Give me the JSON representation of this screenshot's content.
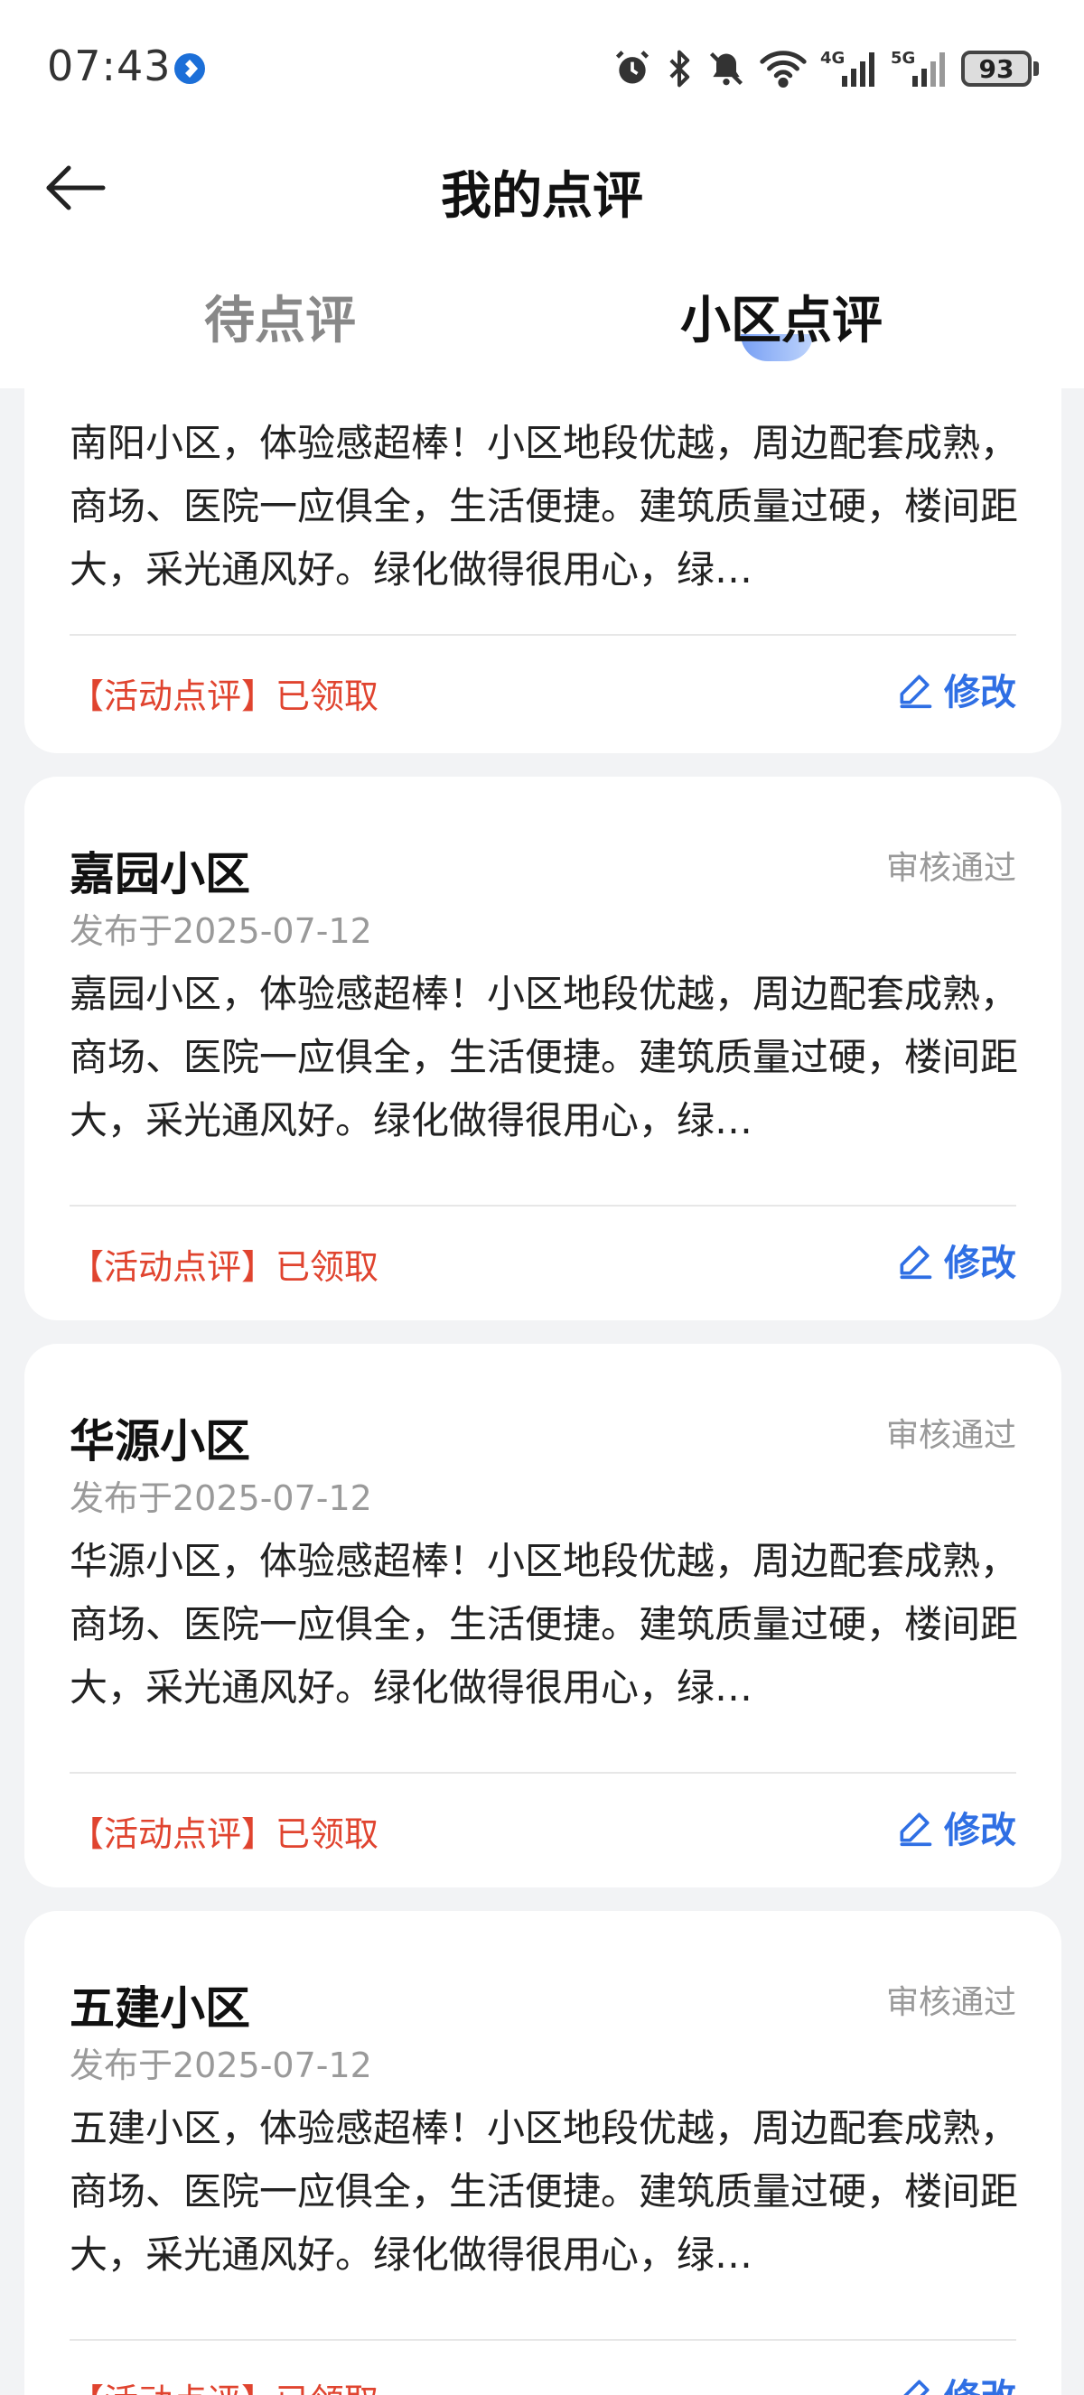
{
  "status_bar": {
    "time": "07:43",
    "icons": [
      "app-badge-icon",
      "alarm-icon",
      "bluetooth-icon",
      "mute-icon",
      "wifi-icon",
      "signal-4g-icon",
      "signal-5g-icon"
    ],
    "signal_4g_label": "4G",
    "signal_5g_label": "5G",
    "battery": "93"
  },
  "header": {
    "title": "我的点评"
  },
  "tabs": [
    {
      "label": "待点评",
      "active": false
    },
    {
      "label": "小区点评",
      "active": true
    }
  ],
  "colors": {
    "accent": "#2f6fe4",
    "tag_red": "#e0442f",
    "muted": "#999999",
    "background": "#f2f3f5"
  },
  "reviews": [
    {
      "name": "",
      "status": "",
      "date": "",
      "body": "南阳小区，体验感超棒！小区地段优越，周边配套成熟，商场、医院一应俱全，生活便捷。建筑质量过硬，楼间距大，采光通风好。绿化做得很用心，绿…",
      "tag": "【活动点评】已领取",
      "edit_label": "修改"
    },
    {
      "name": "嘉园小区",
      "status": "审核通过",
      "date": "发布于2025-07-12",
      "body": "嘉园小区，体验感超棒！小区地段优越，周边配套成熟，商场、医院一应俱全，生活便捷。建筑质量过硬，楼间距大，采光通风好。绿化做得很用心，绿…",
      "tag": "【活动点评】已领取",
      "edit_label": "修改"
    },
    {
      "name": "华源小区",
      "status": "审核通过",
      "date": "发布于2025-07-12",
      "body": "华源小区，体验感超棒！小区地段优越，周边配套成熟，商场、医院一应俱全，生活便捷。建筑质量过硬，楼间距大，采光通风好。绿化做得很用心，绿…",
      "tag": "【活动点评】已领取",
      "edit_label": "修改"
    },
    {
      "name": "五建小区",
      "status": "审核通过",
      "date": "发布于2025-07-12",
      "body": "五建小区，体验感超棒！小区地段优越，周边配套成熟，商场、医院一应俱全，生活便捷。建筑质量过硬，楼间距大，采光通风好。绿化做得很用心，绿…",
      "tag": "【活动点评】已领取",
      "edit_label": "修改"
    }
  ]
}
